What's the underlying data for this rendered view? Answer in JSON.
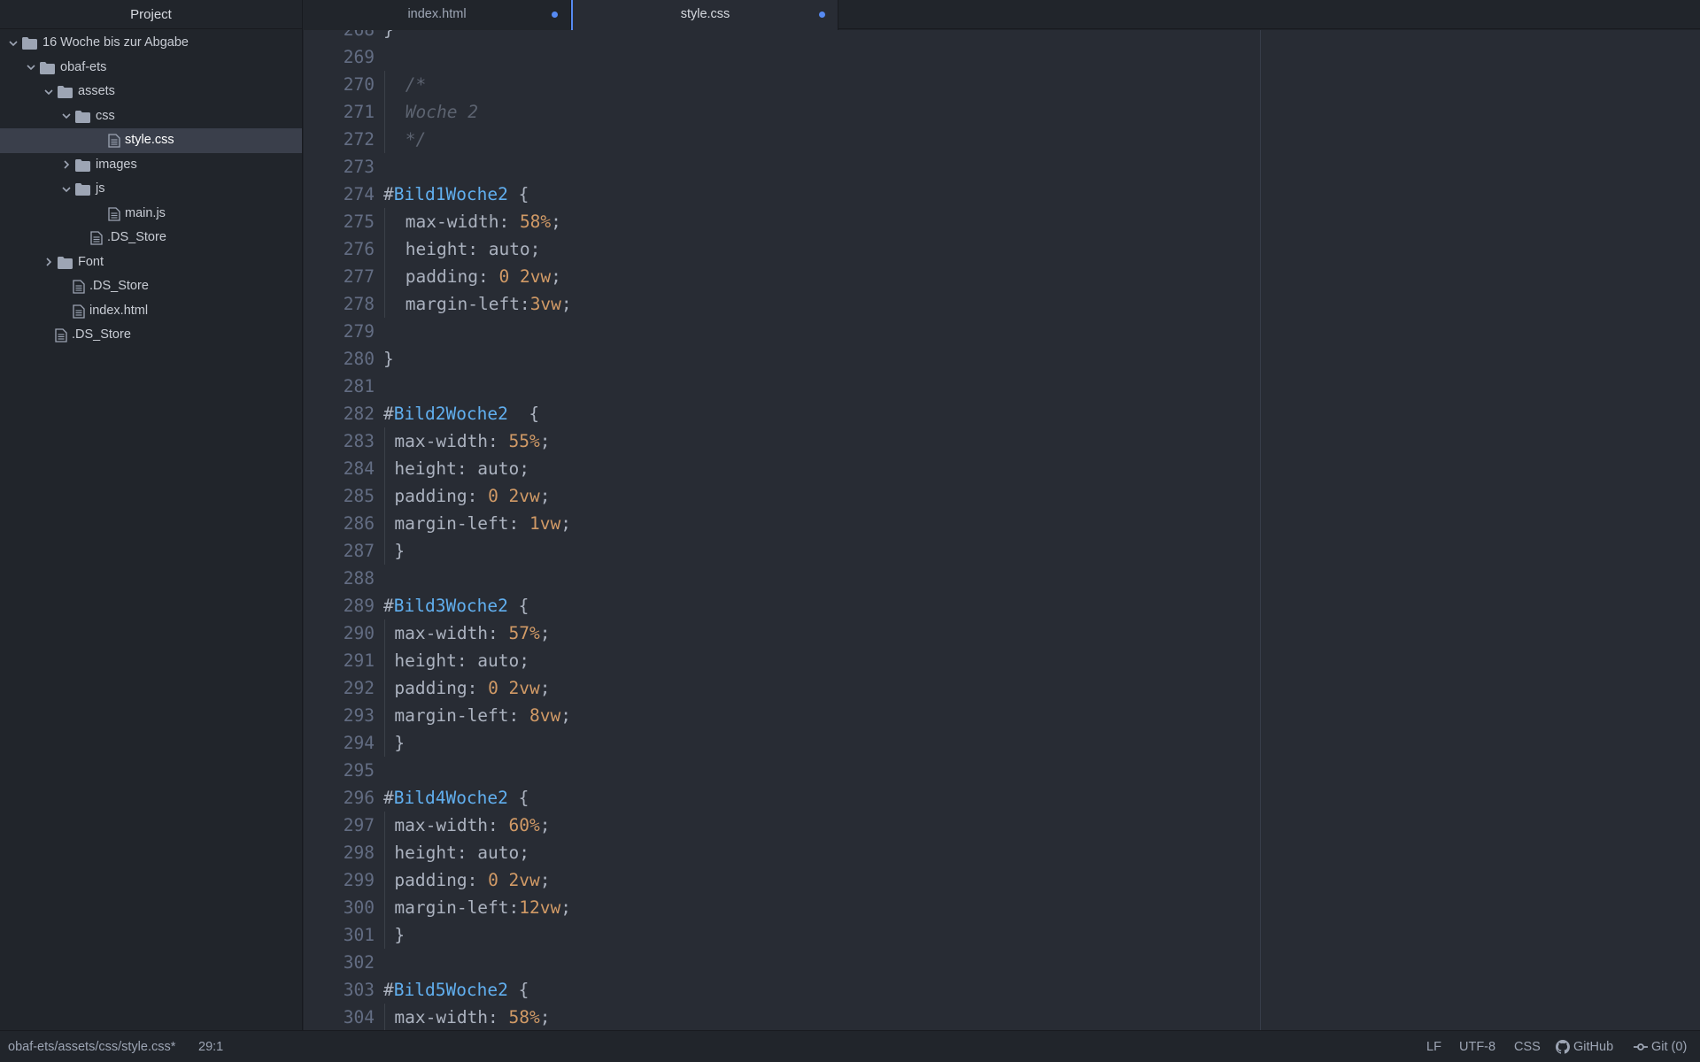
{
  "sidebar": {
    "title": "Project",
    "tree": [
      {
        "label": "16 Woche bis zur Abgabe",
        "type": "folder",
        "depth": 0,
        "expanded": true
      },
      {
        "label": "obaf-ets",
        "type": "folder",
        "depth": 1,
        "expanded": true
      },
      {
        "label": "assets",
        "type": "folder",
        "depth": 2,
        "expanded": true
      },
      {
        "label": "css",
        "type": "folder",
        "depth": 3,
        "expanded": true
      },
      {
        "label": "style.css",
        "type": "file",
        "depth": 4,
        "selected": true
      },
      {
        "label": "images",
        "type": "folder",
        "depth": 3,
        "expanded": false
      },
      {
        "label": "js",
        "type": "folder",
        "depth": 3,
        "expanded": true
      },
      {
        "label": "main.js",
        "type": "file",
        "depth": 4
      },
      {
        "label": ".DS_Store",
        "type": "file",
        "depth": 3
      },
      {
        "label": "Font",
        "type": "folder",
        "depth": 2,
        "expanded": false
      },
      {
        "label": ".DS_Store",
        "type": "file",
        "depth": 2
      },
      {
        "label": "index.html",
        "type": "file",
        "depth": 2
      },
      {
        "label": ".DS_Store",
        "type": "file",
        "depth": 1
      }
    ]
  },
  "tabs": [
    {
      "label": "index.html",
      "active": false,
      "modified": true
    },
    {
      "label": "style.css",
      "active": true,
      "modified": true
    }
  ],
  "editor": {
    "partial_first_line": {
      "number": "268",
      "text": "}"
    },
    "lines": [
      {
        "n": "269",
        "indent": 0,
        "tokens": []
      },
      {
        "n": "270",
        "indent": 1,
        "tokens": [
          {
            "t": "cm",
            "v": "/*"
          }
        ]
      },
      {
        "n": "271",
        "indent": 1,
        "tokens": [
          {
            "t": "cm",
            "v": "Woche 2"
          }
        ]
      },
      {
        "n": "272",
        "indent": 1,
        "tokens": [
          {
            "t": "cm",
            "v": "*/"
          }
        ]
      },
      {
        "n": "273",
        "indent": 0,
        "tokens": []
      },
      {
        "n": "274",
        "indent": 0,
        "tokens": [
          {
            "t": "pl",
            "v": "#"
          },
          {
            "t": "id",
            "v": "Bild1Woche2"
          },
          {
            "t": "pl",
            "v": " {"
          }
        ]
      },
      {
        "n": "275",
        "indent": 1,
        "tokens": [
          {
            "t": "pl",
            "v": "max-width: "
          },
          {
            "t": "nm",
            "v": "58%"
          },
          {
            "t": "pl",
            "v": ";"
          }
        ]
      },
      {
        "n": "276",
        "indent": 1,
        "tokens": [
          {
            "t": "pl",
            "v": "height: auto;"
          }
        ]
      },
      {
        "n": "277",
        "indent": 1,
        "tokens": [
          {
            "t": "pl",
            "v": "padding: "
          },
          {
            "t": "nm",
            "v": "0 2vw"
          },
          {
            "t": "pl",
            "v": ";"
          }
        ]
      },
      {
        "n": "278",
        "indent": 1,
        "tokens": [
          {
            "t": "pl",
            "v": "margin-left:"
          },
          {
            "t": "nm",
            "v": "3vw"
          },
          {
            "t": "pl",
            "v": ";"
          }
        ]
      },
      {
        "n": "279",
        "indent": 0,
        "tokens": []
      },
      {
        "n": "280",
        "indent": 0,
        "tokens": [
          {
            "t": "pl",
            "v": "}"
          }
        ]
      },
      {
        "n": "281",
        "indent": 0,
        "tokens": []
      },
      {
        "n": "282",
        "indent": 0,
        "tokens": [
          {
            "t": "pl",
            "v": "#"
          },
          {
            "t": "id",
            "v": "Bild2Woche2"
          },
          {
            "t": "pl",
            "v": "  {"
          }
        ]
      },
      {
        "n": "283",
        "indent": 0.5,
        "tokens": [
          {
            "t": "pl",
            "v": "max-width: "
          },
          {
            "t": "nm",
            "v": "55%"
          },
          {
            "t": "pl",
            "v": ";"
          }
        ]
      },
      {
        "n": "284",
        "indent": 0.5,
        "tokens": [
          {
            "t": "pl",
            "v": "height: auto;"
          }
        ]
      },
      {
        "n": "285",
        "indent": 0.5,
        "tokens": [
          {
            "t": "pl",
            "v": "padding: "
          },
          {
            "t": "nm",
            "v": "0 2vw"
          },
          {
            "t": "pl",
            "v": ";"
          }
        ]
      },
      {
        "n": "286",
        "indent": 0.5,
        "tokens": [
          {
            "t": "pl",
            "v": "margin-left: "
          },
          {
            "t": "nm",
            "v": "1vw"
          },
          {
            "t": "pl",
            "v": ";"
          }
        ]
      },
      {
        "n": "287",
        "indent": 0.5,
        "tokens": [
          {
            "t": "pl",
            "v": "}"
          }
        ]
      },
      {
        "n": "288",
        "indent": 0,
        "tokens": []
      },
      {
        "n": "289",
        "indent": 0,
        "tokens": [
          {
            "t": "pl",
            "v": "#"
          },
          {
            "t": "id",
            "v": "Bild3Woche2"
          },
          {
            "t": "pl",
            "v": " {"
          }
        ]
      },
      {
        "n": "290",
        "indent": 0.5,
        "tokens": [
          {
            "t": "pl",
            "v": "max-width: "
          },
          {
            "t": "nm",
            "v": "57%"
          },
          {
            "t": "pl",
            "v": ";"
          }
        ]
      },
      {
        "n": "291",
        "indent": 0.5,
        "tokens": [
          {
            "t": "pl",
            "v": "height: auto;"
          }
        ]
      },
      {
        "n": "292",
        "indent": 0.5,
        "tokens": [
          {
            "t": "pl",
            "v": "padding: "
          },
          {
            "t": "nm",
            "v": "0 2vw"
          },
          {
            "t": "pl",
            "v": ";"
          }
        ]
      },
      {
        "n": "293",
        "indent": 0.5,
        "tokens": [
          {
            "t": "pl",
            "v": "margin-left: "
          },
          {
            "t": "nm",
            "v": "8vw"
          },
          {
            "t": "pl",
            "v": ";"
          }
        ]
      },
      {
        "n": "294",
        "indent": 0.5,
        "tokens": [
          {
            "t": "pl",
            "v": "}"
          }
        ]
      },
      {
        "n": "295",
        "indent": 0,
        "tokens": []
      },
      {
        "n": "296",
        "indent": 0,
        "tokens": [
          {
            "t": "pl",
            "v": "#"
          },
          {
            "t": "id",
            "v": "Bild4Woche2"
          },
          {
            "t": "pl",
            "v": " {"
          }
        ]
      },
      {
        "n": "297",
        "indent": 0.5,
        "tokens": [
          {
            "t": "pl",
            "v": "max-width: "
          },
          {
            "t": "nm",
            "v": "60%"
          },
          {
            "t": "pl",
            "v": ";"
          }
        ]
      },
      {
        "n": "298",
        "indent": 0.5,
        "tokens": [
          {
            "t": "pl",
            "v": "height: auto;"
          }
        ]
      },
      {
        "n": "299",
        "indent": 0.5,
        "tokens": [
          {
            "t": "pl",
            "v": "padding: "
          },
          {
            "t": "nm",
            "v": "0 2vw"
          },
          {
            "t": "pl",
            "v": ";"
          }
        ]
      },
      {
        "n": "300",
        "indent": 0.5,
        "tokens": [
          {
            "t": "pl",
            "v": "margin-left:"
          },
          {
            "t": "nm",
            "v": "12vw"
          },
          {
            "t": "pl",
            "v": ";"
          }
        ]
      },
      {
        "n": "301",
        "indent": 0.5,
        "tokens": [
          {
            "t": "pl",
            "v": "}"
          }
        ]
      },
      {
        "n": "302",
        "indent": 0,
        "tokens": []
      },
      {
        "n": "303",
        "indent": 0,
        "tokens": [
          {
            "t": "pl",
            "v": "#"
          },
          {
            "t": "id",
            "v": "Bild5Woche2"
          },
          {
            "t": "pl",
            "v": " {"
          }
        ]
      },
      {
        "n": "304",
        "indent": 0.5,
        "tokens": [
          {
            "t": "pl",
            "v": "max-width: "
          },
          {
            "t": "nm",
            "v": "58%"
          },
          {
            "t": "pl",
            "v": ";"
          }
        ]
      }
    ]
  },
  "statusbar": {
    "file_path": "obaf-ets/assets/css/style.css*",
    "cursor": "29:1",
    "line_ending": "LF",
    "encoding": "UTF-8",
    "grammar": "CSS",
    "github": "GitHub",
    "git": "Git (0)"
  },
  "colors": {
    "accent": "#568af2",
    "comment": "#5c6370",
    "selector_id": "#61afef",
    "number": "#d19a66",
    "text": "#abb2bf",
    "editor_bg": "#282c34",
    "panel_bg": "#21252b"
  }
}
